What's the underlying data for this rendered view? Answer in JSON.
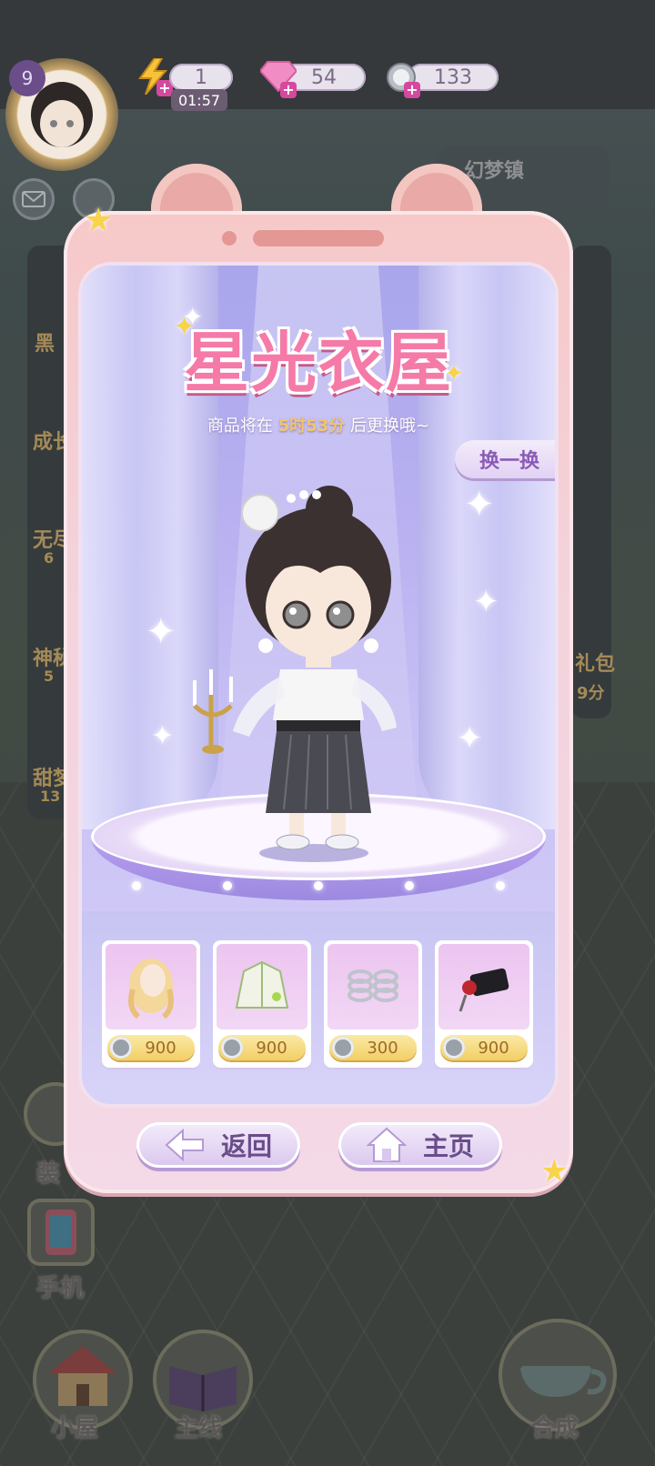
{
  "hud": {
    "level": "9",
    "energy": "1",
    "energy_timer": "01:57",
    "gems": "54",
    "coins": "133"
  },
  "background": {
    "region_label": "幻梦镇",
    "left_labels": [
      "黑",
      "成长",
      "无尽",
      "神秘",
      "甜梦"
    ],
    "left_values": [
      "6",
      "5",
      "13"
    ],
    "right_labels": [
      "礼包",
      "9分"
    ],
    "decorate_label": "装",
    "phone_label": "手机",
    "dock": [
      "小屋",
      "主线",
      "合成"
    ]
  },
  "shop": {
    "title": "星光衣屋",
    "subtitle_prefix": "商品将在 ",
    "subtitle_time": "5时53分",
    "subtitle_suffix": " 后更换哦~",
    "refresh_label": "换一换",
    "items": [
      {
        "icon": "blonde-hair-icon",
        "price": "900"
      },
      {
        "icon": "green-jacket-icon",
        "price": "900"
      },
      {
        "icon": "silver-bracelets-icon",
        "price": "300"
      },
      {
        "icon": "black-rose-bag-icon",
        "price": "900"
      }
    ],
    "back_label": "返回",
    "home_label": "主页"
  },
  "colors": {
    "accent_pink": "#f57aa7",
    "phone_frame": "#f6c9c8",
    "price_gold": "#f2cf66",
    "button_text": "#6a4d8a"
  }
}
